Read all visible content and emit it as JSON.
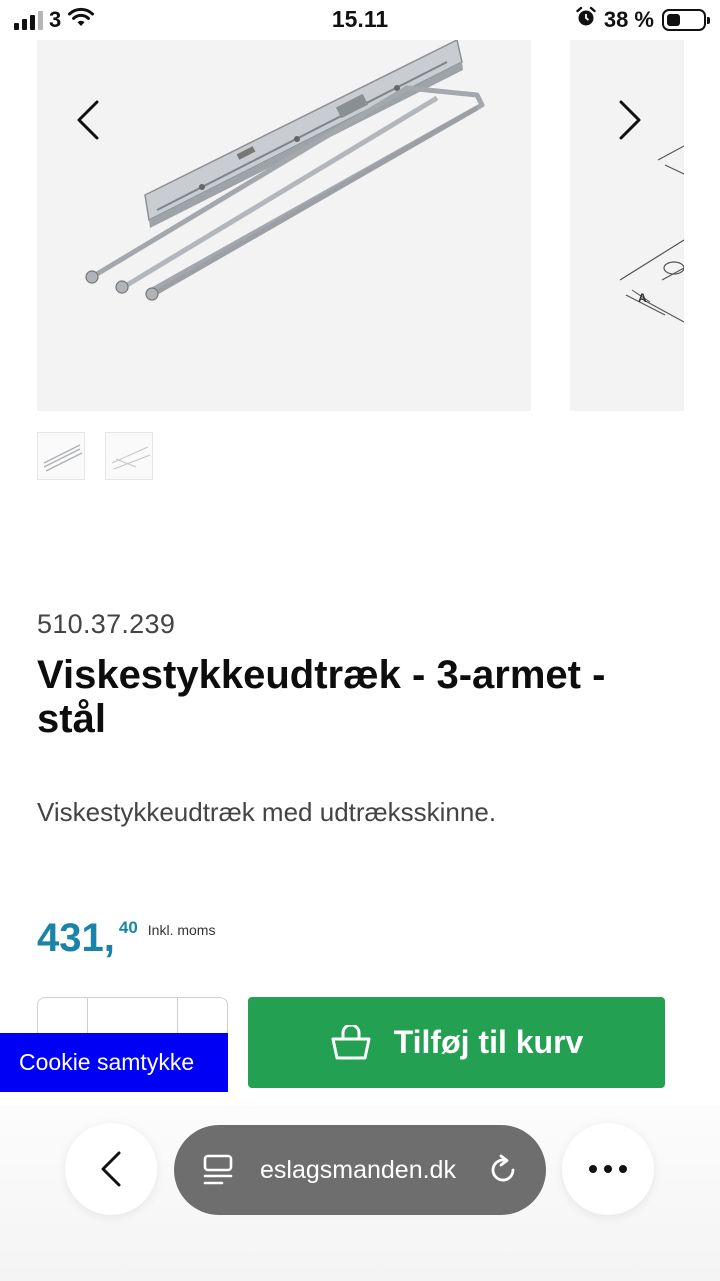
{
  "status_bar": {
    "carrier": "3",
    "time": "15.11",
    "battery": "38 %",
    "battery_level": 0.38,
    "icons": [
      "signal-icon",
      "wifi-icon",
      "alarm-icon",
      "battery-icon"
    ]
  },
  "gallery": {
    "images": [
      "product-photo",
      "dimension-drawing"
    ],
    "drawing_label": "A",
    "prev_icon": "chevron-left-icon",
    "next_icon": "chevron-right-icon"
  },
  "product": {
    "sku": "510.37.239",
    "title": "Viskestykkeudtræk - 3-armet - stål",
    "description": "Viskestykkeudtræk med udtræksskinne.",
    "price_int": "431,",
    "price_dec": "40",
    "price_note": "Inkl. moms"
  },
  "cart": {
    "add_label": "Tilføj til kurv",
    "icon": "basket-icon",
    "button_color": "#23a052"
  },
  "cookie": {
    "label": "Cookie samtykke",
    "color": "#0000f5"
  },
  "browser": {
    "url": "eslagsmanden.dk"
  },
  "colors": {
    "price": "#1a84a8"
  }
}
